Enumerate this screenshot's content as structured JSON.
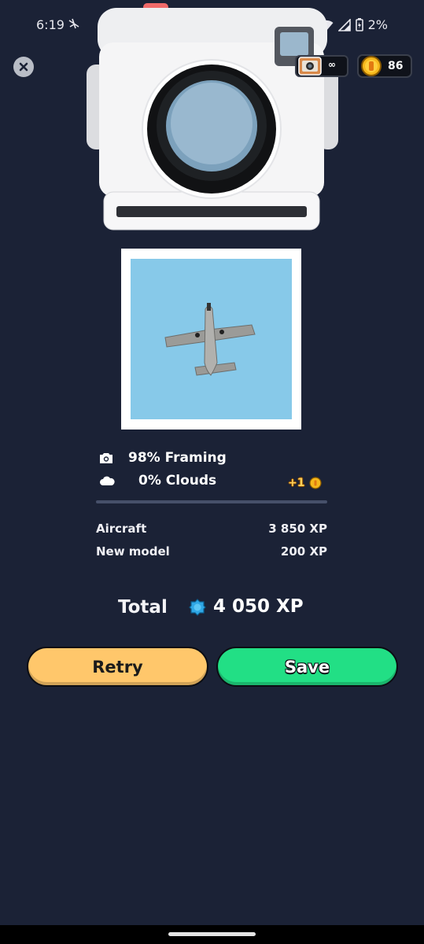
{
  "status_bar": {
    "time": "6:19",
    "battery": "2%"
  },
  "hud": {
    "film_count": "∞",
    "coins": "86"
  },
  "stats": {
    "framing": "98% Framing",
    "clouds": "0% Clouds",
    "bonus": "+1"
  },
  "xp": {
    "rows": [
      {
        "label": "Aircraft",
        "value": "3 850 XP"
      },
      {
        "label": "New model",
        "value": "200 XP"
      }
    ],
    "total_label": "Total",
    "total_value": "4 050 XP"
  },
  "buttons": {
    "retry": "Retry",
    "save": "Save"
  },
  "colors": {
    "background": "#1b2236",
    "retry": "#ffc76b",
    "save": "#22df85",
    "sky": "#87c9e9"
  }
}
